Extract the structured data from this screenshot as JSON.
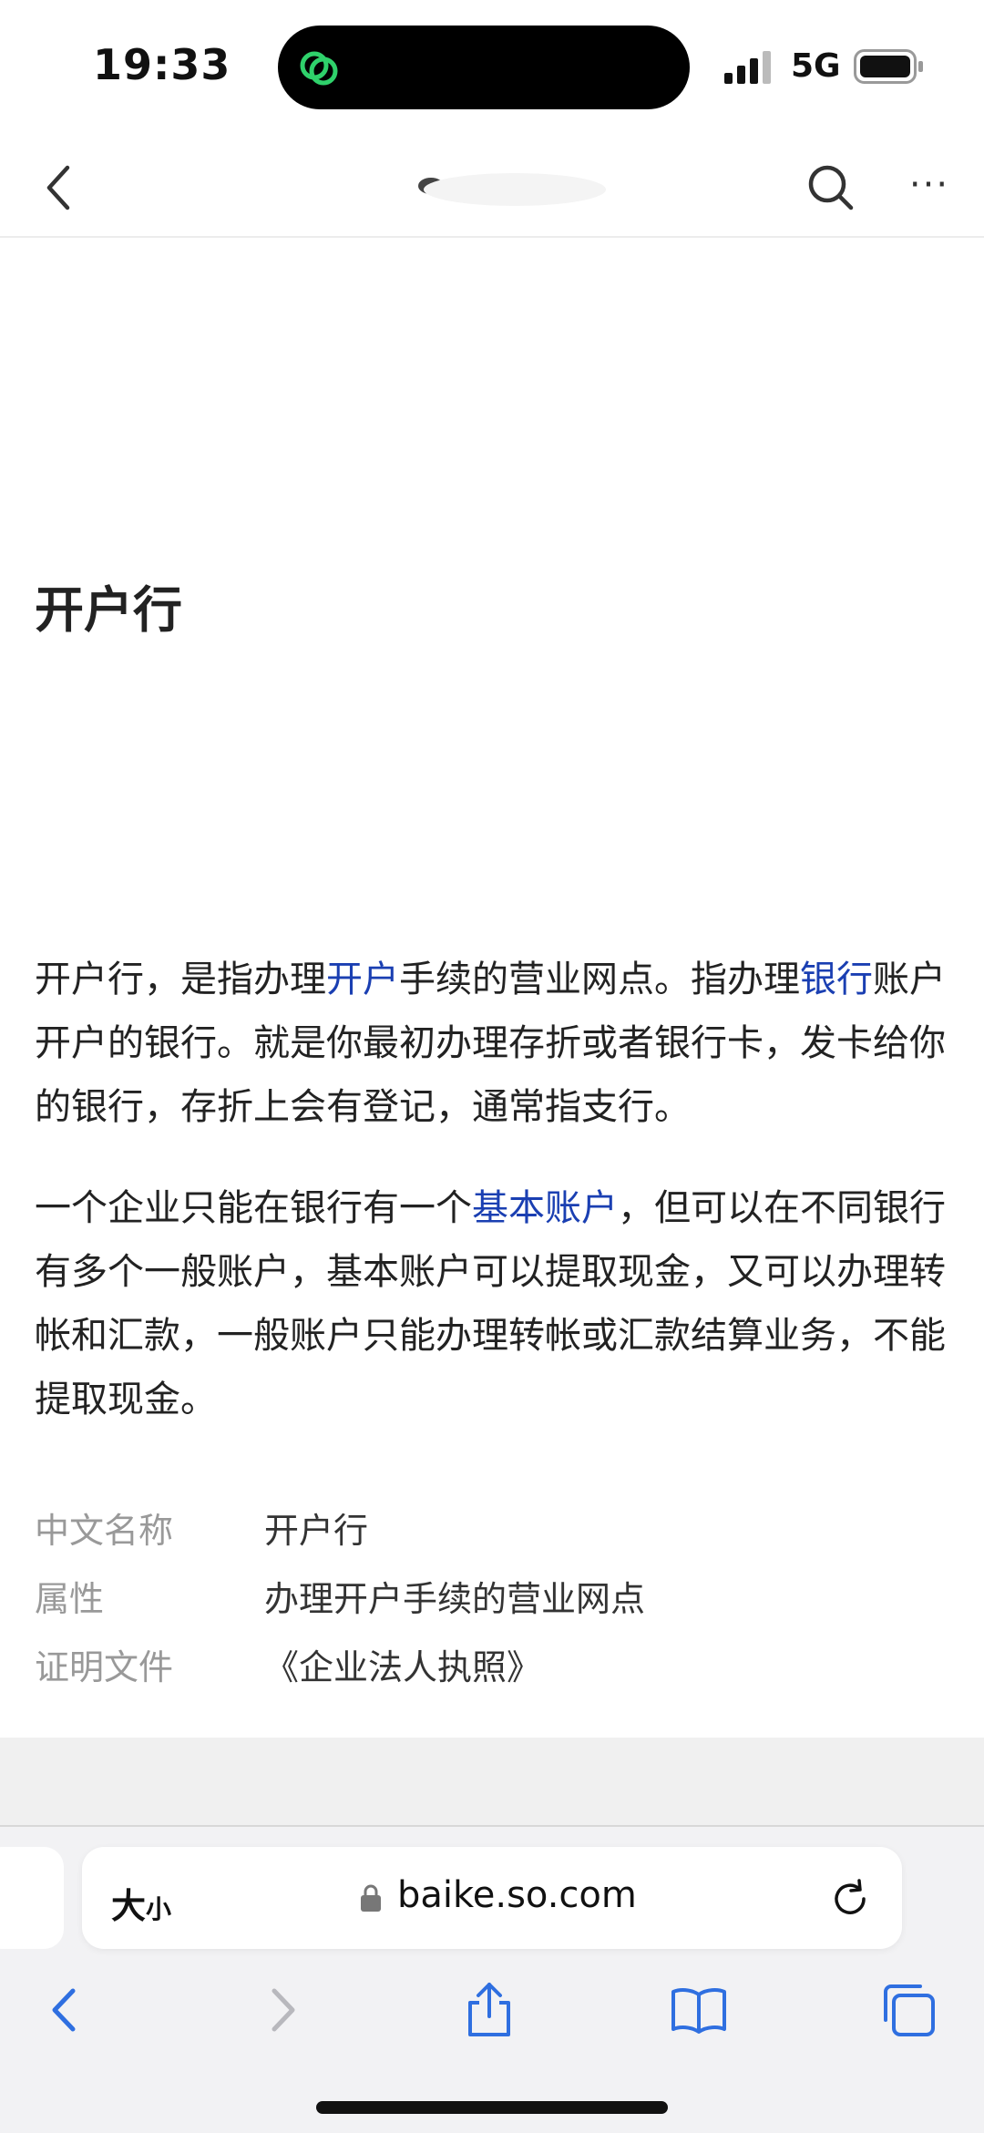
{
  "status_bar": {
    "time": "19:33",
    "network": "5G",
    "island_icon": "chat-bubble-icon",
    "island_icon_color": "#2fd16b"
  },
  "nav": {
    "back_icon": "chevron-left-icon",
    "search_icon": "search-icon",
    "more_label": "···"
  },
  "article": {
    "title": "开户行",
    "p1": {
      "t1": "开户行，是指办理",
      "link1": "开户",
      "t2": "手续的营业网点。指办理",
      "link2": "银行",
      "t3": "账户开户的银行。就是你最初办理存折或者银行卡，发卡给你的银行，存折上会有登记，通常指支行。"
    },
    "p2": {
      "t1": "一个企业只能在银行有一个",
      "link1": "基本账户",
      "t2": "，但可以在不同银行有多个一般账户，基本账户可以提取现金，又可以办理转帐和汇款，一般账户只能办理转帐或汇款结算业务，不能提取现金。"
    },
    "link_color": "#1a3fb2",
    "info": [
      {
        "key": "中文名称",
        "value": "开户行"
      },
      {
        "key": "属性",
        "value": "办理开户手续的营业网点"
      },
      {
        "key": "证明文件",
        "value": "《企业法人执照》"
      }
    ]
  },
  "browser": {
    "text_size_big": "大",
    "text_size_small": "小",
    "url": "baike.so.com",
    "accent": "#2f6fe0"
  }
}
